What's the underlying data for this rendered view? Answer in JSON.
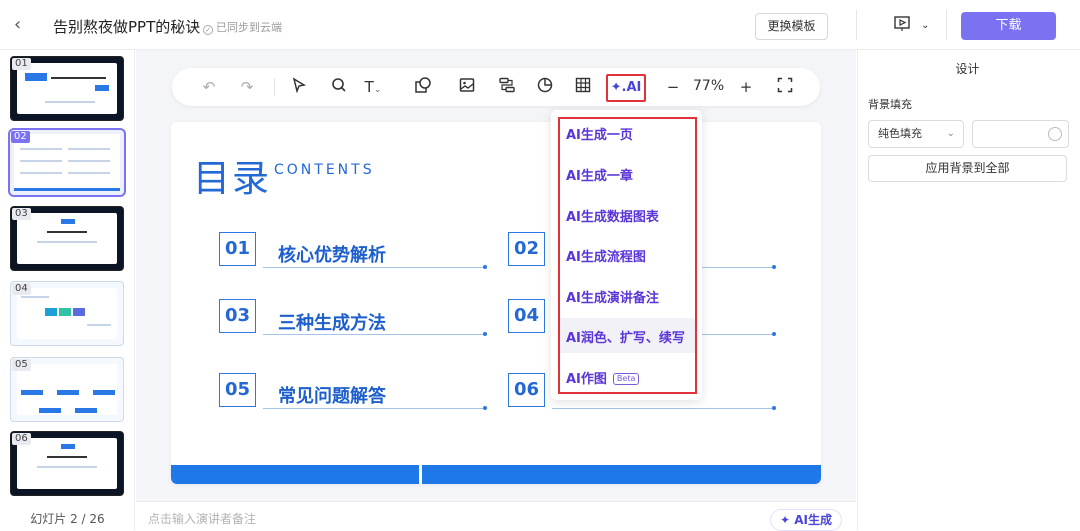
{
  "header": {
    "title": "告别熬夜做PPT的秘诀",
    "sync_status": "已同步到云端",
    "template_button": "更换模板",
    "download_button": "下载"
  },
  "thumbnails": [
    {
      "num": "01"
    },
    {
      "num": "02"
    },
    {
      "num": "03"
    },
    {
      "num": "04"
    },
    {
      "num": "05"
    },
    {
      "num": "06"
    }
  ],
  "slide_counter": "幻灯片 2 / 26",
  "toolbar": {
    "ai_label": "AI",
    "zoom": "77%"
  },
  "slide": {
    "title": "目录",
    "subtitle": "CONTENTS",
    "items": [
      {
        "num": "01",
        "text": "核心优势解析"
      },
      {
        "num": "02",
        "text": ""
      },
      {
        "num": "03",
        "text": "三种生成方法"
      },
      {
        "num": "04",
        "text": ""
      },
      {
        "num": "05",
        "text": "常见问题解答"
      },
      {
        "num": "06",
        "text": ""
      }
    ]
  },
  "ai_menu": {
    "items": [
      "AI生成一页",
      "AI生成一章",
      "AI生成数据图表",
      "AI生成流程图",
      "AI生成演讲备注",
      "AI润色、扩写、续写",
      "AI作图"
    ],
    "beta": "Beta"
  },
  "notes": {
    "placeholder": "点击输入演讲者备注",
    "ai_generate": "AI生成"
  },
  "panel": {
    "title": "设计",
    "background_label": "背景填充",
    "fill_type": "纯色填充",
    "apply_all": "应用背景到全部"
  },
  "colors": {
    "accent": "#7b72f2",
    "slide_blue": "#2468d6",
    "highlight_red": "#e0323a",
    "ai_purple": "#5a35d8"
  }
}
